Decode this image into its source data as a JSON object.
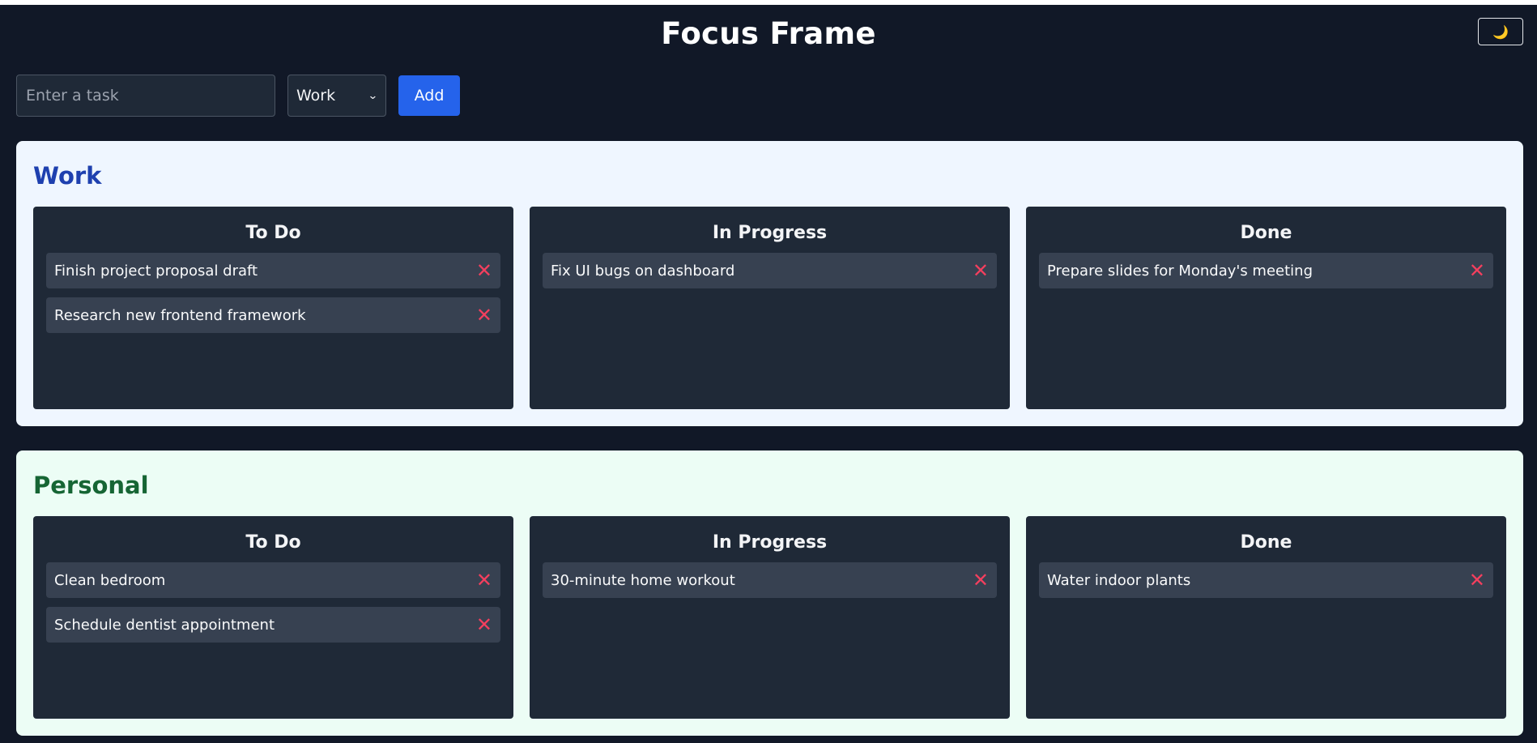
{
  "app": {
    "title": "Focus Frame",
    "theme_icon": "🌙"
  },
  "form": {
    "input_placeholder": "Enter a task",
    "input_value": "",
    "category_selected": "Work",
    "add_label": "Add"
  },
  "colors": {
    "background": "#111827",
    "accent": "#2563eb",
    "delete": "#f43f5e",
    "work_panel": "#eff6ff",
    "personal_panel": "#ecfdf5"
  },
  "categories": [
    {
      "name": "Work",
      "columns": [
        {
          "title": "To Do",
          "tasks": [
            "Finish project proposal draft",
            "Research new frontend framework"
          ]
        },
        {
          "title": "In Progress",
          "tasks": [
            "Fix UI bugs on dashboard"
          ]
        },
        {
          "title": "Done",
          "tasks": [
            "Prepare slides for Monday's meeting"
          ]
        }
      ]
    },
    {
      "name": "Personal",
      "columns": [
        {
          "title": "To Do",
          "tasks": [
            "Clean bedroom",
            "Schedule dentist appointment"
          ]
        },
        {
          "title": "In Progress",
          "tasks": [
            "30-minute home workout"
          ]
        },
        {
          "title": "Done",
          "tasks": [
            "Water indoor plants"
          ]
        }
      ]
    }
  ],
  "icons": {
    "delete": "✕",
    "theme": "moon-icon",
    "select": "chevron-down-icon"
  }
}
